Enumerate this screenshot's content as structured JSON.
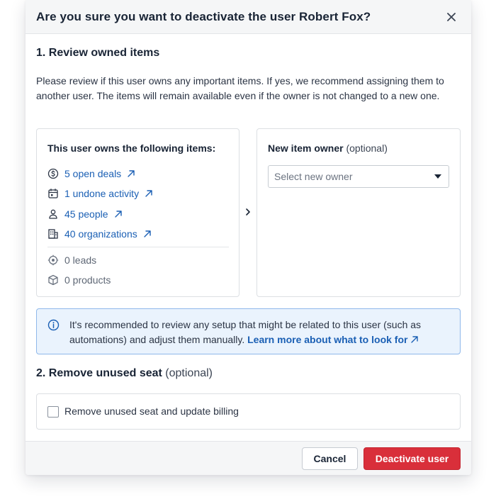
{
  "dialog": {
    "title": "Are you sure you want to deactivate the user Robert Fox?",
    "close_icon": "close-icon"
  },
  "section1": {
    "title": "1. Review owned items",
    "description": "Please review if this user owns any important items. If yes, we recommend assigning them to another user. The items will remain available even if the owner is not changed to a new one."
  },
  "owned_items": {
    "title": "This user owns the following items:",
    "linked": [
      {
        "label": "5 open deals",
        "icon": "dollar-circle-icon"
      },
      {
        "label": "1 undone activity",
        "icon": "calendar-icon"
      },
      {
        "label": "45 people",
        "icon": "person-icon"
      },
      {
        "label": "40 organizations",
        "icon": "building-icon"
      }
    ],
    "unlinked": [
      {
        "label": "0 leads",
        "icon": "target-icon"
      },
      {
        "label": "0 products",
        "icon": "box-icon"
      }
    ]
  },
  "new_owner": {
    "title": "New item owner",
    "optional": "(optional)",
    "placeholder": "Select new owner"
  },
  "info": {
    "text": "It's recommended to review any setup that might be related to this user (such as automations) and adjust them manually.",
    "link": "Learn more about what to look for"
  },
  "section2": {
    "title": "2. Remove unused seat",
    "optional": "(optional)",
    "checkbox_label": "Remove unused seat and update billing",
    "checked": false
  },
  "footer": {
    "cancel_label": "Cancel",
    "deactivate_label": "Deactivate user"
  },
  "colors": {
    "link": "#1a5fb4",
    "danger": "#d92f3a",
    "info_bg": "#eaf3fd",
    "info_border": "#8fb8ea"
  }
}
